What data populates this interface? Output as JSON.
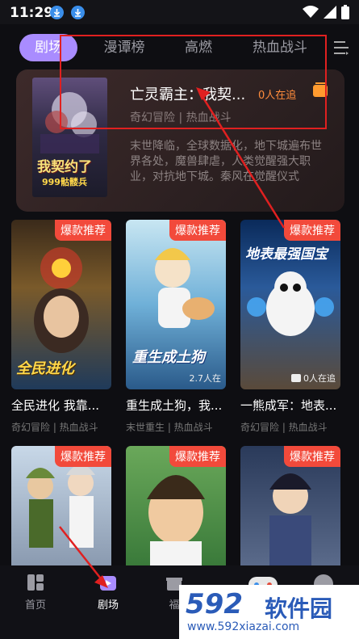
{
  "status_bar": {
    "time": "11:29"
  },
  "tabs": [
    {
      "label": "剧场",
      "active": true
    },
    {
      "label": "漫谭榜"
    },
    {
      "label": "高燃"
    },
    {
      "label": "热血战斗"
    }
  ],
  "featured": {
    "title": "亡灵霸主：我契...",
    "follow": "0人在追",
    "tags": "奇幻冒险 | 热血战斗",
    "description": "末世降临，全球数据化，地下城遍布世界各处，魔兽肆虐，人类觉醒强大职业，对抗地下城。秦风在觉醒仪式",
    "cover_text_1": "我契约了",
    "cover_text_2": "999骷髅兵"
  },
  "cards": [
    {
      "badge": "爆款推荐",
      "title": "全民进化 我靠...",
      "tags": "奇幻冒险 | 热血战斗",
      "cover_text": "全民进化"
    },
    {
      "badge": "爆款推荐",
      "title": "重生成土狗，我...",
      "tags": "末世重生 | 热血战斗",
      "cover_text": "重生成土狗",
      "follow": "2.7人在"
    },
    {
      "badge": "爆款推荐",
      "title": "一熊成军：地表...",
      "tags": "奇幻冒险 | 热血战斗",
      "cover_text": "地表最强国宝",
      "follow": "0人在追"
    },
    {
      "badge": "爆款推荐"
    },
    {
      "badge": "爆款推荐"
    },
    {
      "badge": "爆款推荐"
    }
  ],
  "bottom_nav": [
    {
      "label": "首页"
    },
    {
      "label": "剧场",
      "active": true
    },
    {
      "label": "福"
    }
  ],
  "watermark": {
    "brand": "592",
    "brand_cn": "软件园",
    "url": "www.592xiazai.com"
  },
  "colors": {
    "accent": "#a98cff",
    "badge": "#f24a3b",
    "follow": "#ff8c3c",
    "annotation": "#e02020"
  }
}
